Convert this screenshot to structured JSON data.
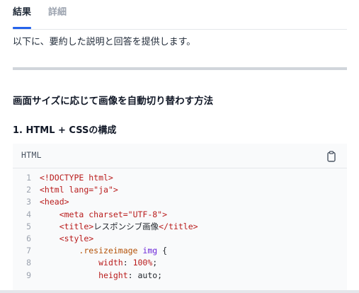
{
  "tabs": [
    {
      "label": "結果",
      "active": true
    },
    {
      "label": "詳細",
      "active": false
    }
  ],
  "intro": "以下に、要約した説明と回答を提供します。",
  "heading": "画面サイズに応じて画像を自動切り替わす方法",
  "subheading": "1. HTML + CSSの構成",
  "code": {
    "language": "HTML",
    "copy_icon": "clipboard-icon",
    "lines": [
      {
        "n": "1",
        "parts": [
          {
            "t": "<!DOCTYPE html>",
            "c": "tag"
          }
        ]
      },
      {
        "n": "2",
        "parts": [
          {
            "t": "<html ",
            "c": "tag"
          },
          {
            "t": "lang=",
            "c": "attr"
          },
          {
            "t": "\"ja\"",
            "c": "str"
          },
          {
            "t": ">",
            "c": "tag"
          }
        ]
      },
      {
        "n": "3",
        "parts": [
          {
            "t": "<head>",
            "c": "tag"
          }
        ]
      },
      {
        "n": "4",
        "parts": [
          {
            "t": "    ",
            "c": "txt"
          },
          {
            "t": "<meta ",
            "c": "tag"
          },
          {
            "t": "charset=",
            "c": "attr"
          },
          {
            "t": "\"UTF-8\"",
            "c": "str"
          },
          {
            "t": ">",
            "c": "tag"
          }
        ]
      },
      {
        "n": "5",
        "parts": [
          {
            "t": "    ",
            "c": "txt"
          },
          {
            "t": "<title>",
            "c": "tag"
          },
          {
            "t": "レスポンシブ画像",
            "c": "txt"
          },
          {
            "t": "</title>",
            "c": "tag"
          }
        ]
      },
      {
        "n": "6",
        "parts": [
          {
            "t": "    ",
            "c": "txt"
          },
          {
            "t": "<style>",
            "c": "tag"
          }
        ]
      },
      {
        "n": "7",
        "parts": [
          {
            "t": "        ",
            "c": "txt"
          },
          {
            "t": ".resizeimage ",
            "c": "sel"
          },
          {
            "t": "img",
            "c": "kw"
          },
          {
            "t": " {",
            "c": "txt"
          }
        ]
      },
      {
        "n": "8",
        "parts": [
          {
            "t": "            ",
            "c": "txt"
          },
          {
            "t": "width",
            "c": "prop"
          },
          {
            "t": ": ",
            "c": "txt"
          },
          {
            "t": "100%",
            "c": "str"
          },
          {
            "t": ";",
            "c": "txt"
          }
        ]
      },
      {
        "n": "9",
        "parts": [
          {
            "t": "            ",
            "c": "txt"
          },
          {
            "t": "height",
            "c": "prop"
          },
          {
            "t": ": auto;",
            "c": "txt"
          }
        ]
      }
    ]
  }
}
